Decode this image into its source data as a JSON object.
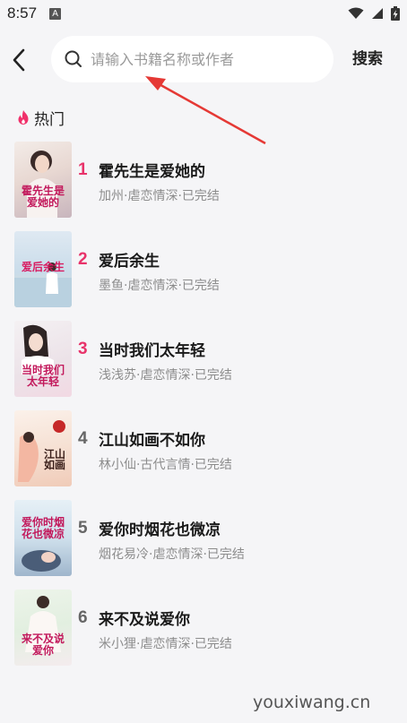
{
  "status_bar": {
    "time": "8:57",
    "notification_badge": "A",
    "icons": [
      "wifi-icon",
      "signal-icon",
      "battery-charging-icon"
    ]
  },
  "header": {
    "back_icon": "chevron-left-icon",
    "search_icon": "search-icon",
    "search_placeholder": "请输入书籍名称或作者",
    "search_value": "",
    "search_button": "搜索"
  },
  "hot_section": {
    "icon": "flame-icon",
    "title": "热门"
  },
  "colors": {
    "rank_top": "#e8336a",
    "rank_other": "#666666",
    "annotation_arrow": "#e53935",
    "flame": "#f0306a"
  },
  "books": [
    {
      "rank": "1",
      "title": "霍先生是爱她的",
      "meta": "加州·虐恋情深·已完结",
      "cover_text": "霍先生是爱她的"
    },
    {
      "rank": "2",
      "title": "爱后余生",
      "meta": "墨鱼·虐恋情深·已完结",
      "cover_text": "爱后余生"
    },
    {
      "rank": "3",
      "title": "当时我们太年轻",
      "meta": "浅浅苏·虐恋情深·已完结",
      "cover_text": "当时我们太年轻"
    },
    {
      "rank": "4",
      "title": "江山如画不如你",
      "meta": "林小仙·古代言情·已完结",
      "cover_text": "江山如画"
    },
    {
      "rank": "5",
      "title": "爱你时烟花也微凉",
      "meta": "烟花易冷·虐恋情深·已完结",
      "cover_text": "爱你时烟花也微凉"
    },
    {
      "rank": "6",
      "title": "来不及说爱你",
      "meta": "米小狸·虐恋情深·已完结",
      "cover_text": "来不及说爱你"
    }
  ],
  "watermark": "youxiwang.cn"
}
